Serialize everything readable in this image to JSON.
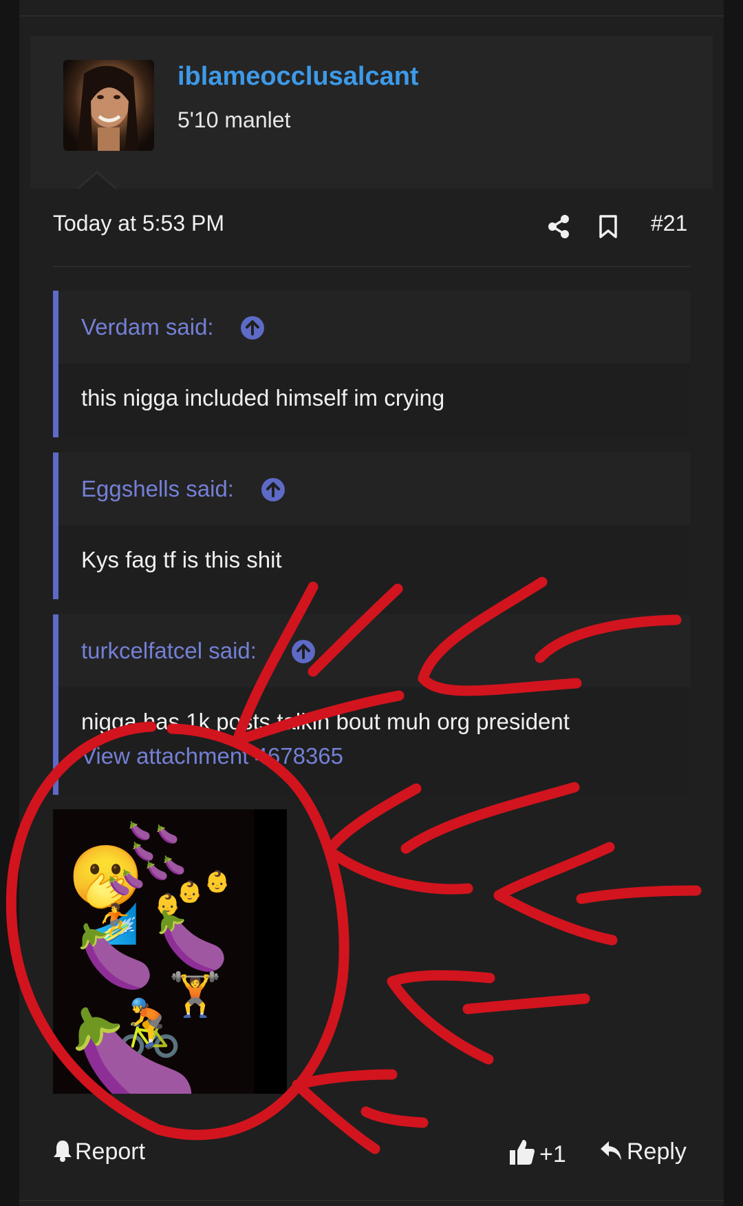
{
  "post": {
    "username": "iblameocclusalcant",
    "user_title": "5'10 manlet",
    "timestamp": "Today at 5:53 PM",
    "post_number": "#21",
    "icons": {
      "share": "share-icon",
      "bookmark": "bookmark-icon",
      "quote_jump": "arrow-up-circle-icon",
      "report": "bell-icon",
      "like": "thumbs-up-icon",
      "reply": "reply-icon"
    }
  },
  "quotes": [
    {
      "author": "Verdam said:",
      "text": "this nigga included himself im crying"
    },
    {
      "author": "Eggshells said:",
      "text": "Kys fag tf is this shit"
    },
    {
      "author": "turkcelfatcel said:",
      "text": "nigga has 1k posts talkin bout muh org president",
      "attachment_link": "View attachment 4678365"
    }
  ],
  "attachment": {
    "emoji": [
      "🫢",
      "🍆",
      "🍆",
      "🍆",
      "🍆",
      "🍆",
      "🍆",
      "🍆",
      "👶",
      "👶",
      "👶",
      "🏄",
      "🍆",
      "🍆",
      "🏋",
      "🚴",
      "🍆"
    ]
  },
  "footer": {
    "report_label": "Report",
    "like_count": "+1",
    "reply_label": "Reply"
  },
  "colors": {
    "username": "#3d9ae8",
    "quote_accent": "#5d6ac6",
    "annotation_red": "#d2141e"
  }
}
